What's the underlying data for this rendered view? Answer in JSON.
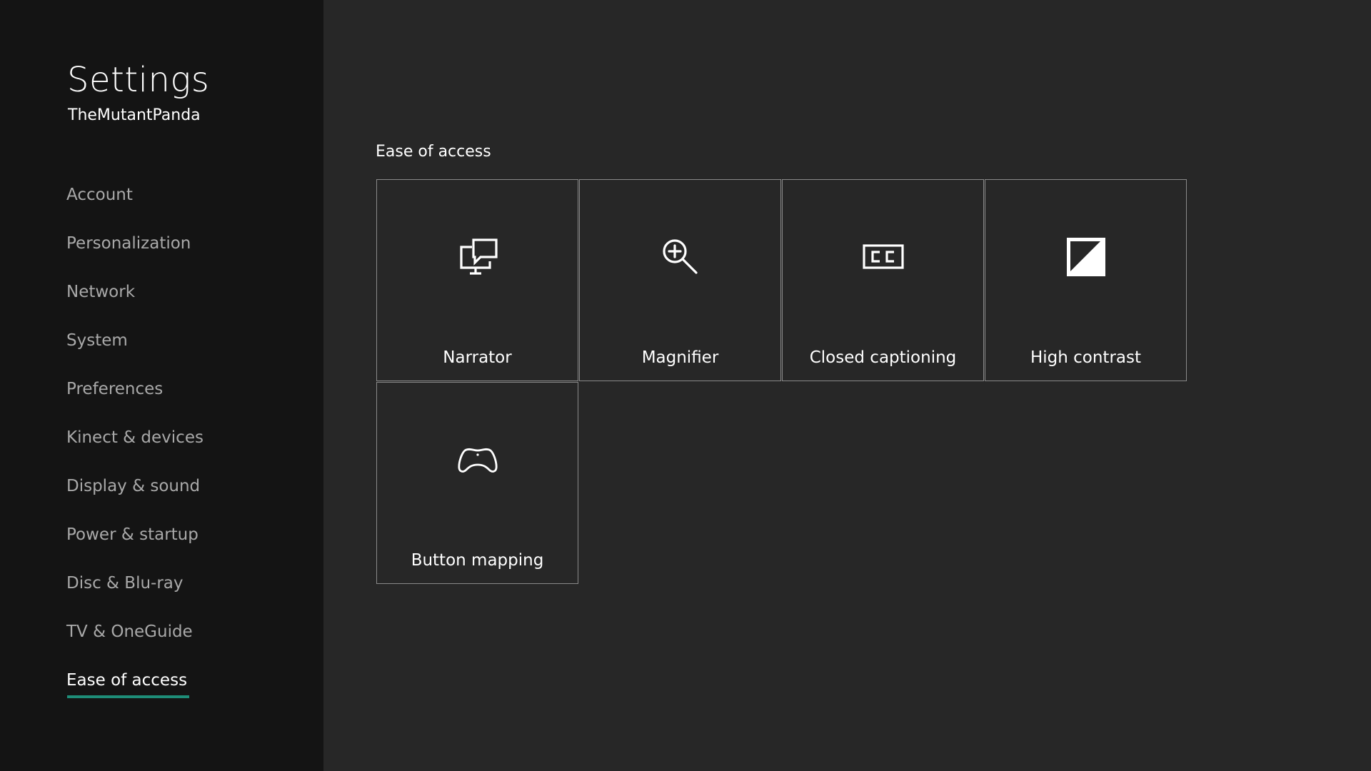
{
  "sidebar": {
    "title": "Settings",
    "user": "TheMutantPanda",
    "items": [
      {
        "label": "Account"
      },
      {
        "label": "Personalization"
      },
      {
        "label": "Network"
      },
      {
        "label": "System"
      },
      {
        "label": "Preferences"
      },
      {
        "label": "Kinect & devices"
      },
      {
        "label": "Display & sound"
      },
      {
        "label": "Power & startup"
      },
      {
        "label": "Disc & Blu-ray"
      },
      {
        "label": "TV & OneGuide"
      },
      {
        "label": "Ease of access"
      }
    ],
    "active_item": "Ease of access"
  },
  "main": {
    "heading": "Ease of access",
    "tiles": [
      {
        "label": "Narrator",
        "icon": "narrator-icon"
      },
      {
        "label": "Magnifier",
        "icon": "magnifier-icon"
      },
      {
        "label": "Closed captioning",
        "icon": "closed-captioning-icon"
      },
      {
        "label": "High contrast",
        "icon": "high-contrast-icon"
      },
      {
        "label": "Button mapping",
        "icon": "controller-icon"
      }
    ]
  },
  "colors": {
    "sidebar_bg": "#141414",
    "content_bg": "#272727",
    "accent": "#1e8d78",
    "inactive_text": "#a9a9a9",
    "tile_border": "#8a8a8a"
  }
}
